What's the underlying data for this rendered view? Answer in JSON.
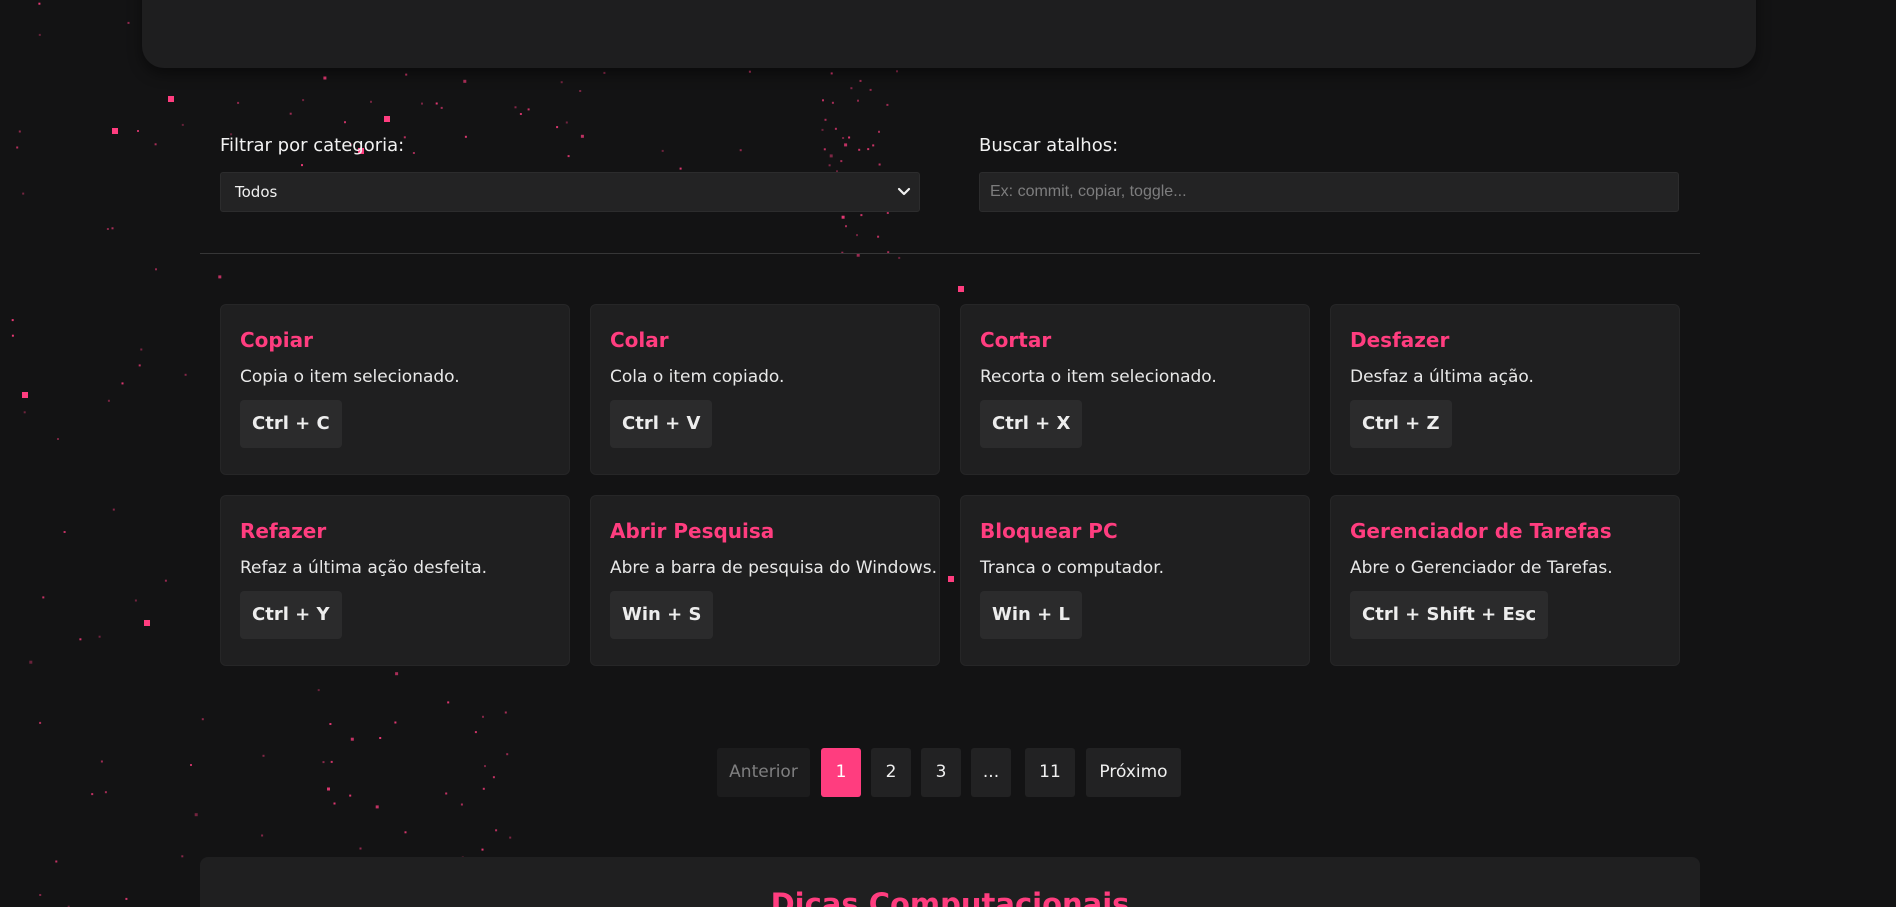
{
  "theme": {
    "accent": "#ff3d7f",
    "background": "#131314",
    "card_background": "#1f1f20",
    "key_background": "#2b2b2c"
  },
  "filters": {
    "category_label": "Filtrar por categoria:",
    "category_selected": "Todos",
    "search_label": "Buscar atalhos:",
    "search_placeholder": "Ex: commit, copiar, toggle...",
    "search_value": ""
  },
  "shortcuts": [
    {
      "title": "Copiar",
      "description": "Copia o item selecionado.",
      "keys": "Ctrl + C"
    },
    {
      "title": "Colar",
      "description": "Cola o item copiado.",
      "keys": "Ctrl + V"
    },
    {
      "title": "Cortar",
      "description": "Recorta o item selecionado.",
      "keys": "Ctrl + X"
    },
    {
      "title": "Desfazer",
      "description": "Desfaz a última ação.",
      "keys": "Ctrl + Z"
    },
    {
      "title": "Refazer",
      "description": "Refaz a última ação desfeita.",
      "keys": "Ctrl + Y"
    },
    {
      "title": "Abrir Pesquisa",
      "description": "Abre a barra de pesquisa do Windows.",
      "keys": "Win + S"
    },
    {
      "title": "Bloquear PC",
      "description": "Tranca o computador.",
      "keys": "Win + L"
    },
    {
      "title": "Gerenciador de Tarefas",
      "description": "Abre o Gerenciador de Tarefas.",
      "keys": "Ctrl + Shift + Esc"
    }
  ],
  "pagination": {
    "prev_label": "Anterior",
    "next_label": "Próximo",
    "pages": [
      "1",
      "2",
      "3",
      "...",
      "11"
    ],
    "current_page": 1
  },
  "bottom_section": {
    "title": "Dicas Computacionais"
  }
}
